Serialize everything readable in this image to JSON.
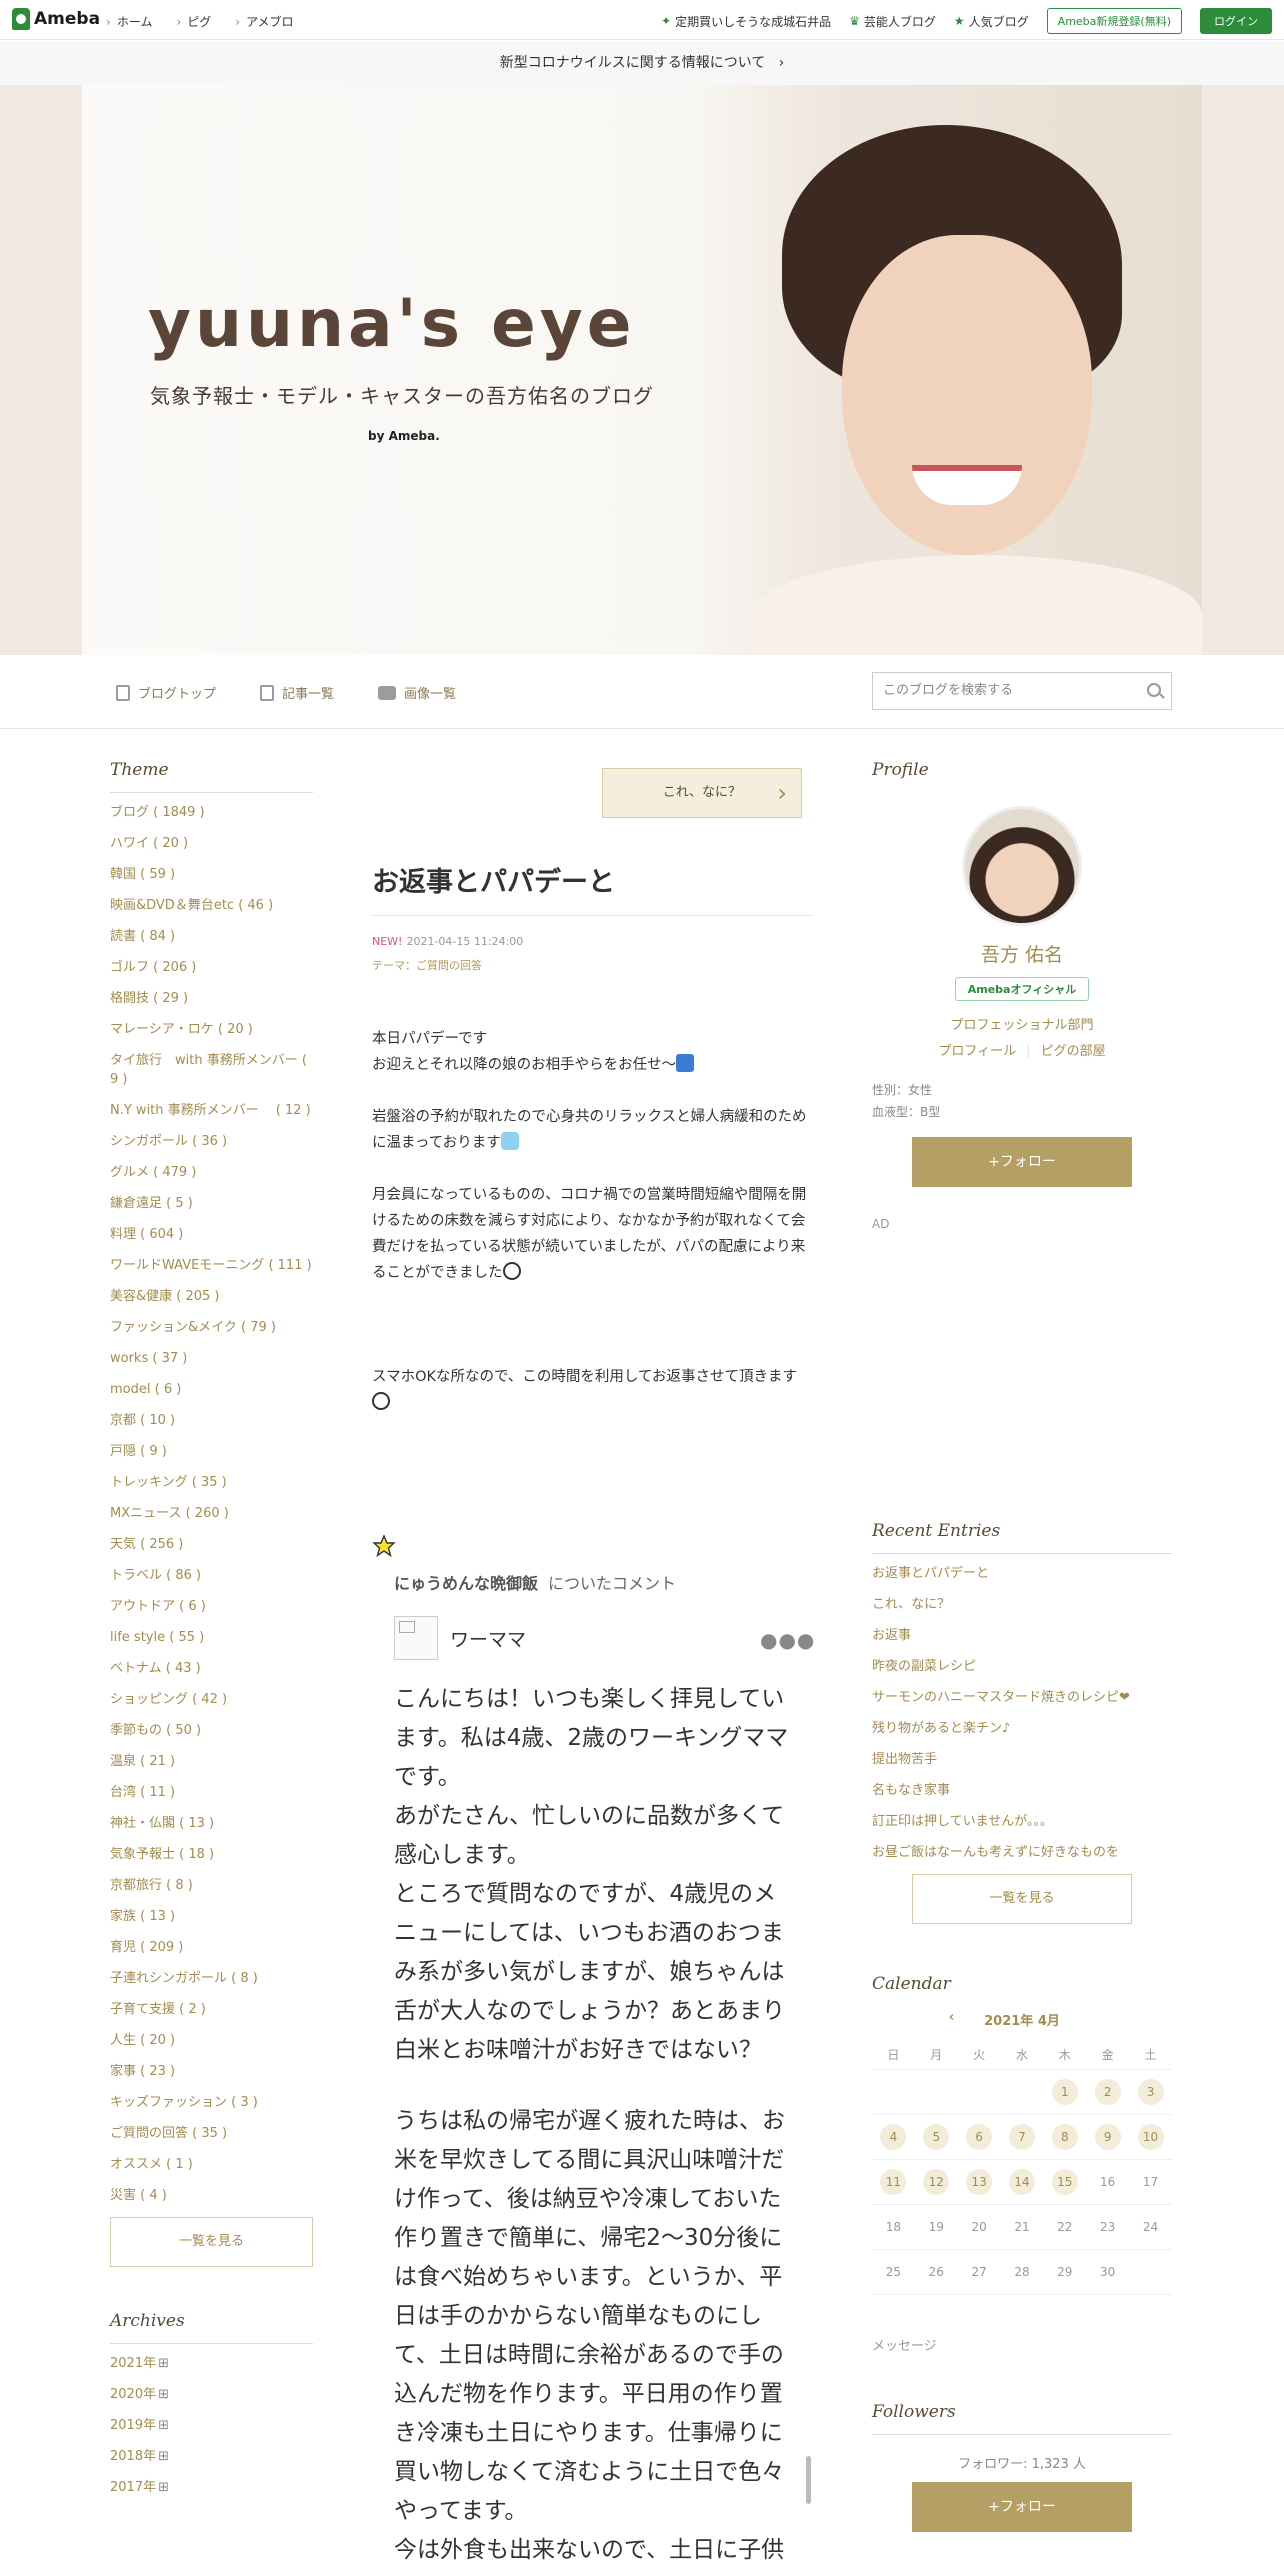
{
  "topbar": {
    "logo": "Ameba",
    "nav": [
      "ホーム",
      "ピグ",
      "アメブロ"
    ],
    "picks": [
      "定期買いしそうな成城石井品",
      "芸能人ブログ",
      "人気ブログ"
    ],
    "register": "Ameba新規登録(無料)",
    "login": "ログイン"
  },
  "notice": "新型コロナウイルスに関する情報について",
  "banner": {
    "title": "yuuna's eye",
    "subtitle": "気象予報士・モデル・キャスターの吾方佑名のブログ",
    "by": "by Ameba."
  },
  "blognav": {
    "items": [
      "ブログトップ",
      "記事一覧",
      "画像一覧"
    ],
    "search_placeholder": "このブログを検索する"
  },
  "left": {
    "theme_heading": "Theme",
    "themes": [
      "ブログ ( 1849 )",
      "ハワイ ( 20 )",
      "韓国 ( 59 )",
      "映画&DVD＆舞台etc ( 46 )",
      "読書 ( 84 )",
      "ゴルフ ( 206 )",
      "格闘技 ( 29 )",
      "マレーシア・ロケ ( 20 )",
      "タイ旅行　with 事務所メンバー ( 9 )",
      "N.Y with 事務所メンバー　 ( 12 )",
      "シンガポール ( 36 )",
      "グルメ ( 479 )",
      "鎌倉遠足 ( 5 )",
      "料理 ( 604 )",
      "ワールドWAVEモーニング ( 111 )",
      "美容&健康 ( 205 )",
      "ファッション&メイク ( 79 )",
      "works ( 37 )",
      "model ( 6 )",
      "京都 ( 10 )",
      "戸隠 ( 9 )",
      "トレッキング ( 35 )",
      "MXニュース ( 260 )",
      "天気 ( 256 )",
      "トラベル ( 86 )",
      "アウトドア ( 6 )",
      "life style ( 55 )",
      "ベトナム ( 43 )",
      "ショッピング ( 42 )",
      "季節もの ( 50 )",
      "温泉 ( 21 )",
      "台湾 ( 11 )",
      "神社・仏閣 ( 13 )",
      "気象予報士 ( 18 )",
      "京都旅行 ( 8 )",
      "家族 ( 13 )",
      "育児 ( 209 )",
      "子連れシンガポール ( 8 )",
      "子育て支援 ( 2 )",
      "人生 ( 20 )",
      "家事 ( 23 )",
      "キッズファッション ( 3 )",
      "ご質問の回答 ( 35 )",
      "オススメ ( 1 )",
      "災害 ( 4 )"
    ],
    "more": "一覧を見る",
    "archives_heading": "Archives",
    "archives": [
      "2021年",
      "2020年",
      "2019年",
      "2018年",
      "2017年"
    ]
  },
  "main": {
    "whats_button": "これ、なに？",
    "title": "お返事とパパデーと",
    "new_badge": "NEW!",
    "date": "2021-04-15 11:24:00",
    "theme": "テーマ：ご質問の回答",
    "para1_a": "本日パパデーです",
    "para1_b": "お迎えとそれ以降の娘のお相手やらをお任せ～",
    "para2": "岩盤浴の予約が取れたので心身共のリラックスと婦人病緩和のために温まっております",
    "para3": "月会員になっているものの、コロナ禍での営業時間短縮や間隔を開けるための床数を減らす対応により、なかなか予約が取れなくて会費だけを払っている状態が続いていましたが、パパの配慮により来ることができました",
    "para4": "スマホOKな所なので、この時間を利用してお返事させて頂きます",
    "comment_target": "にゅうめんな晩御飯",
    "comment_suffix": "についたコメント",
    "commenter": "ワーママ",
    "comment_p1": "こんにちは！いつも楽しく拝見しています。私は4歳、2歳のワーキングママです。",
    "comment_p2": "あがたさん、忙しいのに品数が多くて感心します。",
    "comment_p3": "ところで質問なのですが、4歳児のメニューにしては、いつもお酒のおつまみ系が多い気がしますが、娘ちゃんは舌が大人なのでしょうか？あとあまり白米とお味噌汁がお好きではない？",
    "comment_p4": "うちは私の帰宅が遅く疲れた時は、お米を早炊きしてる間に具沢山味噌汁だけ作って、後は納豆や冷凍しておいた作り置きで簡単に、帰宅2〜30分後には食べ始めちゃいます。というか、平日は手のかからない簡単なものにして、土日は時間に余裕があるので手の込んだ物を作ります。平日用の作り置き冷凍も土日にやります。仕事帰りに買い物しなくて済むように土日で色々やってます。",
    "comment_p5": "今は外食も出来ないので、土日に子供"
  },
  "right": {
    "profile_heading": "Profile",
    "name": "吾方 佑名",
    "official": "Amebaオフィシャル",
    "category": "プロフェッショナル部門",
    "link_profile": "プロフィール",
    "link_pig": "ピグの部屋",
    "gender": "性別：女性",
    "blood": "血液型：B型",
    "follow": "+フォロー",
    "ad": "AD",
    "recent_heading": "Recent Entries",
    "recent": [
      "お返事とパパデーと",
      "これ、なに？",
      "お返事",
      "昨夜の副菜レシピ",
      "サーモンのハニーマスタード焼きのレシピ❤",
      "残り物があると楽チン♪",
      "提出物苦手",
      "名もなき家事",
      "訂正印は押していませんが。。。",
      "お昼ご飯はなーんも考えずに好きなものを"
    ],
    "recent_more": "一覧を見る",
    "calendar_heading": "Calendar",
    "calendar_month": "2021年 4月",
    "weekdays": [
      "日",
      "月",
      "火",
      "水",
      "木",
      "金",
      "土"
    ],
    "message": "メッセージ",
    "followers_heading": "Followers",
    "followers_count": "フォロワー: 1,323 人",
    "follow2": "+フォロー"
  },
  "colors": {
    "accent": "#a38c4f",
    "brand": "#2d8c3c",
    "button_gold": "#b49f65"
  }
}
